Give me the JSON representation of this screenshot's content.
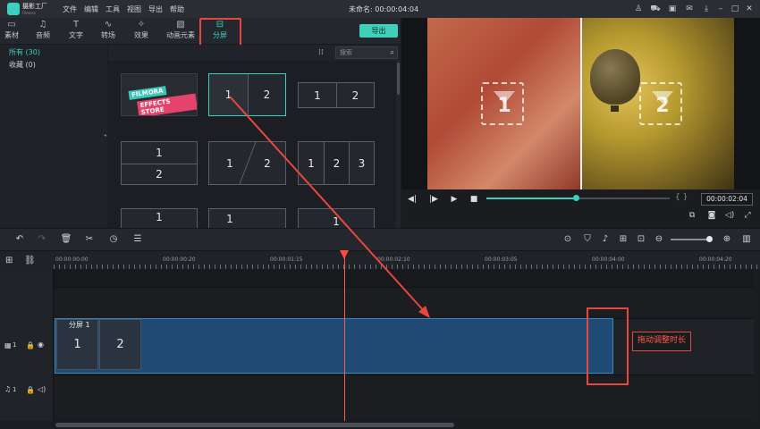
{
  "app": {
    "name": "摄影工厂",
    "subtitle": "Filmora"
  },
  "menu": [
    "文件",
    "编辑",
    "工具",
    "视图",
    "导出",
    "帮助"
  ],
  "window_title": "未命名: 00:00:04:04",
  "tabs": [
    {
      "label": "素材",
      "icon": "folder-icon"
    },
    {
      "label": "音频",
      "icon": "music-icon"
    },
    {
      "label": "文字",
      "icon": "text-icon"
    },
    {
      "label": "转场",
      "icon": "transition-icon"
    },
    {
      "label": "效果",
      "icon": "effects-icon"
    },
    {
      "label": "动画元素",
      "icon": "elements-icon"
    },
    {
      "label": "分屏",
      "icon": "split-screen-icon",
      "active": true
    }
  ],
  "export_label": "导出",
  "sidebar": [
    {
      "label": "所有 (30)",
      "active": true
    },
    {
      "label": "收藏 (0)",
      "active": false
    }
  ],
  "search": {
    "placeholder": "搜索"
  },
  "fx_tile": {
    "line1": "FILMORA",
    "line2": "EFFECTS STORE"
  },
  "split_tiles": {
    "t1": [
      "1",
      "2"
    ],
    "t2": [
      "1",
      "2"
    ],
    "t3": [
      "1",
      "2"
    ],
    "t4": [
      "1",
      "2"
    ],
    "t5": [
      "1",
      "2",
      "3"
    ],
    "t6": [
      "1"
    ],
    "t7": [
      "1"
    ],
    "t8": [
      "1"
    ]
  },
  "preview": {
    "left_num": "1",
    "right_num": "2",
    "time": "00:00:02:04",
    "progress": 0.49,
    "brackets": "{  }"
  },
  "ruler_labels": [
    "00:00:00:00",
    "00:00:00:20",
    "00:00:01:15",
    "00:00:02:10",
    "00:00:03:05",
    "00:00:04:00",
    "00:00:04:20"
  ],
  "clip": {
    "label": "分屏 1",
    "cells": [
      "1",
      "2"
    ]
  },
  "track_labels": {
    "video": "1",
    "audio": "1"
  },
  "annotation": {
    "note": "拖动调整时长"
  },
  "colors": {
    "accent": "#3ad1c0",
    "annotation": "#e8483c",
    "clip": "#1f4a73"
  }
}
